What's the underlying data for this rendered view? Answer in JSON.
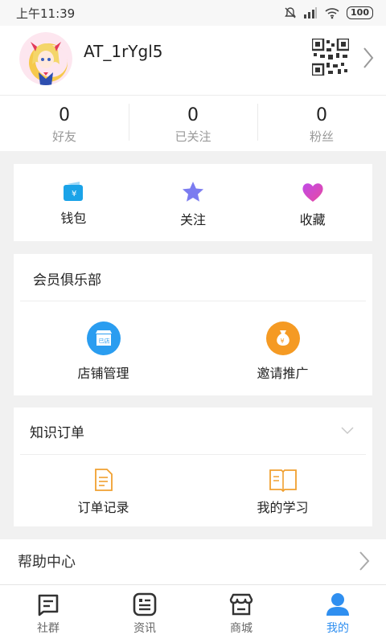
{
  "status_bar": {
    "time": "上午11:39",
    "battery": "100"
  },
  "profile": {
    "username": "AT_1rYgl5"
  },
  "stats": [
    {
      "value": "0",
      "label": "好友"
    },
    {
      "value": "0",
      "label": "已关注"
    },
    {
      "value": "0",
      "label": "粉丝"
    }
  ],
  "quick_actions": [
    {
      "label": "钱包",
      "icon": "wallet-icon",
      "color": "#1aa3e8"
    },
    {
      "label": "关注",
      "icon": "star-icon",
      "color": "#7b7cf0"
    },
    {
      "label": "收藏",
      "icon": "heart-icon",
      "color": "#b04ae0"
    }
  ],
  "club": {
    "title": "会员俱乐部",
    "items": [
      {
        "label": "店铺管理",
        "icon": "store-icon",
        "badge": "已店",
        "color": "#2a9df0"
      },
      {
        "label": "邀请推广",
        "icon": "money-bag-icon",
        "color": "#f59a23"
      }
    ]
  },
  "orders": {
    "title": "知识订单",
    "items": [
      {
        "label": "订单记录",
        "icon": "document-icon",
        "color": "#f0a030"
      },
      {
        "label": "我的学习",
        "icon": "book-icon",
        "color": "#f0a030"
      }
    ]
  },
  "partial_row": {
    "label": "帮助中心"
  },
  "tabbar": [
    {
      "label": "社群",
      "icon": "community-icon",
      "active": false
    },
    {
      "label": "资讯",
      "icon": "news-icon",
      "active": false
    },
    {
      "label": "商城",
      "icon": "shop-icon",
      "active": false
    },
    {
      "label": "我的",
      "icon": "profile-icon",
      "active": true
    }
  ],
  "colors": {
    "accent": "#2f8ff0",
    "background": "#f1f1f1"
  }
}
